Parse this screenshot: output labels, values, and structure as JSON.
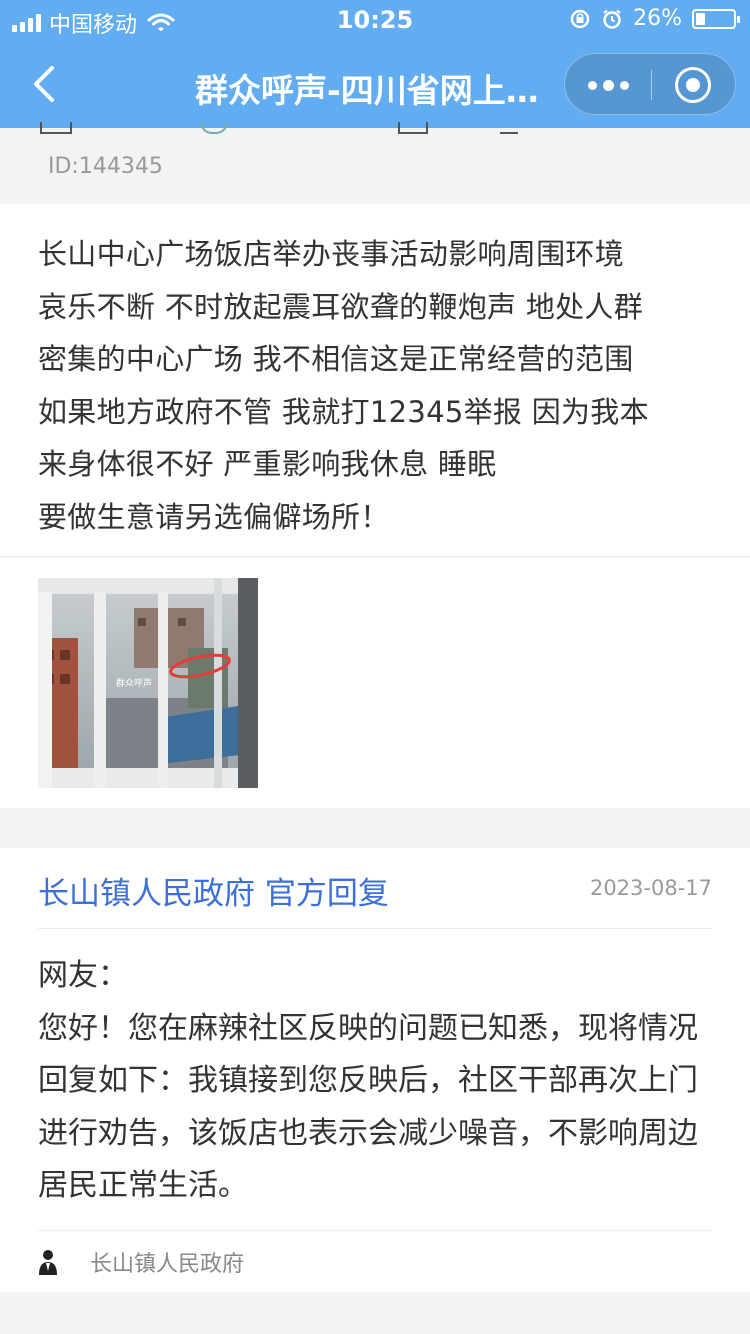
{
  "status_bar": {
    "carrier": "中国移动",
    "time": "10:25",
    "battery_percent": "26%",
    "battery_level": 0.26
  },
  "nav": {
    "title": "群众呼声-四川省网上群众工作平台",
    "more_icon": "more-dots-icon",
    "close_icon": "target-close-icon",
    "back_icon": "chevron-left-icon"
  },
  "post": {
    "id_label": "ID:144345",
    "content": "长山中心广场饭店举办丧事活动影响周围环境\n哀乐不断 不时放起震耳欲聋的鞭炮声 地处人群\n密集的中心广场 我不相信这是正常经营的范围\n如果地方政府不管 我就打12345举报 因为我本\n来身体很不好 严重影响我休息 睡眠\n要做生意请另选偏僻场所！",
    "photo_watermark": "群众呼声"
  },
  "reply": {
    "header": "长山镇人民政府 官方回复",
    "date": "2023-08-17",
    "greeting": "网友：",
    "body": "您好！您在麻辣社区反映的问题已知悉，现将情况回复如下：我镇接到您反映后，社区干部再次上门进行劝告，该饭店也表示会减少噪音，不影响周边居民正常生活。",
    "signature": "长山镇人民政府"
  },
  "colors": {
    "nav_bg": "#62acf1",
    "reply_header": "#3d6fd9"
  }
}
